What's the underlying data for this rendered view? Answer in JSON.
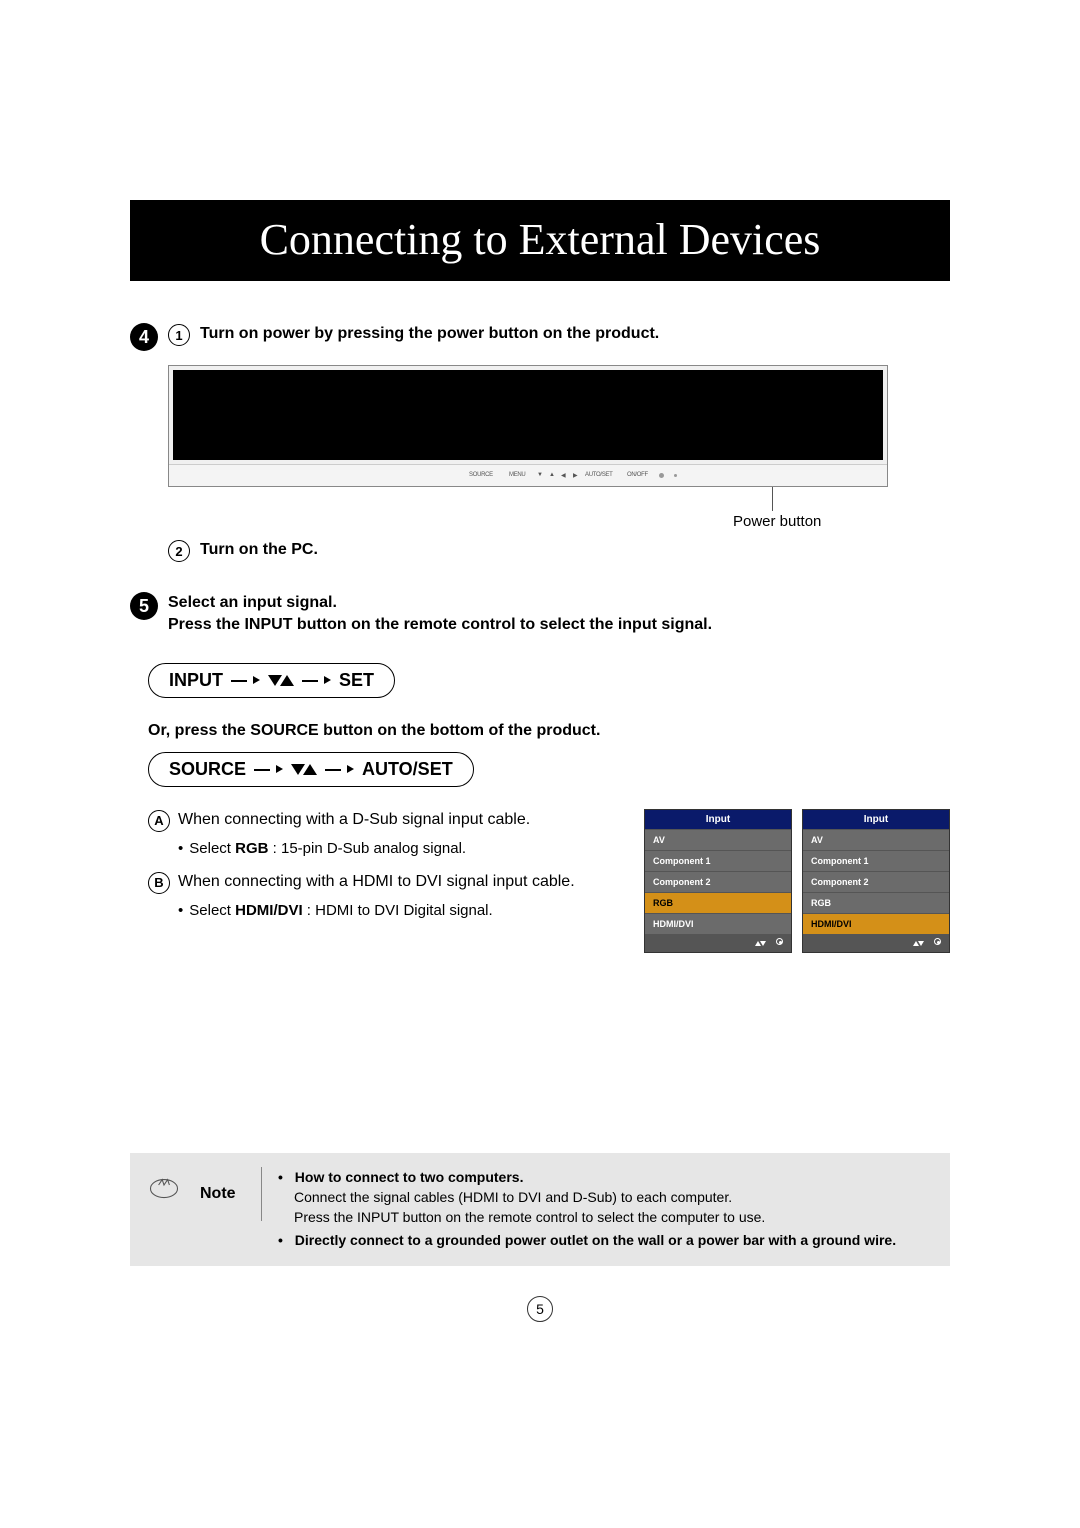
{
  "title": "Connecting to External Devices",
  "step4": {
    "num": "4",
    "sub1_num": "1",
    "sub1_text": "Turn on power by pressing the power button on the product.",
    "monitor_labels": [
      "SOURCE",
      "MENU",
      "AUTO/SET",
      "ON/OFF"
    ],
    "power_label": "Power button",
    "sub2_num": "2",
    "sub2_text": "Turn on the PC."
  },
  "step5": {
    "num": "5",
    "line1": "Select an input signal.",
    "line2": "Press the INPUT button on the remote control to select the input signal.",
    "pill1_a": "INPUT",
    "pill1_b": "SET",
    "or_text": "Or, press the SOURCE button on the bottom of the product.",
    "pill2_a": "SOURCE",
    "pill2_b": "AUTO/SET",
    "A_letter": "A",
    "A_text": "When connecting with a D-Sub signal input cable.",
    "A_sub_pre": "Select ",
    "A_sub_bold": "RGB",
    "A_sub_post": " : 15-pin D-Sub analog signal.",
    "B_letter": "B",
    "B_text": "When connecting with a HDMI to DVI signal input cable.",
    "B_sub_pre": "Select ",
    "B_sub_bold": "HDMI/DVI",
    "B_sub_post": " : HDMI to DVI Digital signal.",
    "osd_title": "Input",
    "osd_items": [
      "AV",
      "Component 1",
      "Component 2",
      "RGB",
      "HDMI/DVI"
    ],
    "osd_sel_a": "RGB",
    "osd_sel_b": "HDMI/DVI"
  },
  "note": {
    "label": "Note",
    "b1_bold": "How to connect to two computers.",
    "b1_line1_a": "Connect the signal cables (",
    "b1_line1_b": "HDMI to DVI",
    "b1_line1_c": " and D-Sub) to each computer.",
    "b1_line2": "Press the INPUT button on the remote control to select the computer to use.",
    "b2_bold": "Directly connect to a grounded power outlet on the wall or a power bar with a ground wire."
  },
  "page_number": "5"
}
